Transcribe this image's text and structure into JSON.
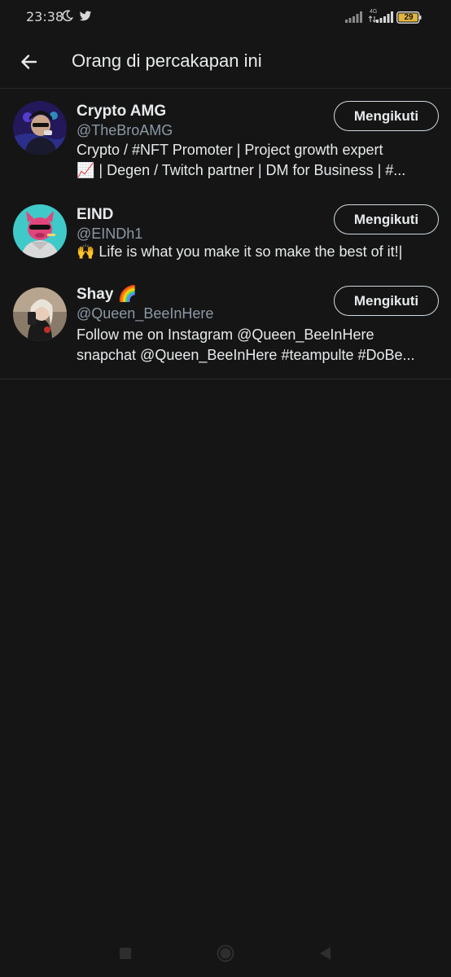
{
  "status_bar": {
    "time": "23:38",
    "network_type": "4G",
    "battery_level": "29",
    "icons": [
      "moon-icon",
      "twitter-icon",
      "signal-icon",
      "battery-icon"
    ]
  },
  "header": {
    "title": "Orang di percakapan ini",
    "back_icon": "arrow-left-icon"
  },
  "people": [
    {
      "name": "Crypto AMG",
      "handle": "@TheBroAMG",
      "bio_lines": [
        "Crypto / #NFT Promoter | Project growth expert",
        "📈 | Degen / Twitch partner | DM for Business | #..."
      ],
      "follow_label": "Mengikuti"
    },
    {
      "name": "EIND",
      "handle": "@EINDh1",
      "bio_lines": [
        "🙌 Life is what you make it so make the best of it!|"
      ],
      "follow_label": "Mengikuti"
    },
    {
      "name": "Shay 🌈",
      "handle": "@Queen_BeeInHere",
      "bio_lines": [
        "Follow me on Instagram @Queen_BeeInHere",
        "snapchat @Queen_BeeInHere #teampulte #DoBe..."
      ],
      "follow_label": "Mengikuti"
    }
  ],
  "colors": {
    "background": "#151515",
    "text_primary": "#e7e9ea",
    "text_secondary": "#8b98a5",
    "divider": "#2a2a2a",
    "button_border": "#cfd9de"
  },
  "nav_bar": {
    "icons": [
      "recents-square-icon",
      "home-circle-icon",
      "back-triangle-icon"
    ]
  }
}
